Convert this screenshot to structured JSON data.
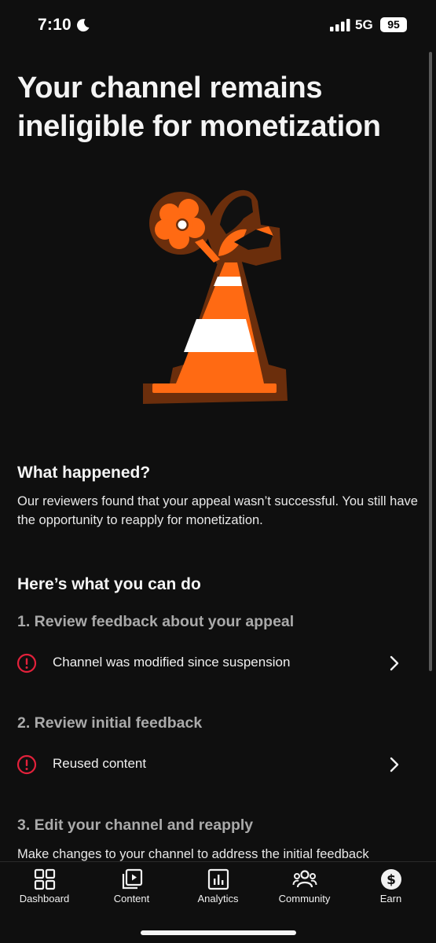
{
  "status_bar": {
    "time": "7:10",
    "network": "5G",
    "battery": "95"
  },
  "page": {
    "title": "Your channel remains ineligible for monetization",
    "what_happened": {
      "heading": "What happened?",
      "body": "Our reviewers found that your appeal wasn’t successful. You still have the opportunity to reapply for monetization."
    },
    "what_you_can_do": {
      "heading": "Here’s what you can do",
      "step1": {
        "heading": "1. Review feedback about your appeal",
        "item": "Channel was modified since suspension"
      },
      "step2": {
        "heading": "2. Review initial feedback",
        "item": "Reused content"
      },
      "step3": {
        "heading": "3. Edit your channel and reapply",
        "body": "Make changes to your channel to address the initial feedback"
      }
    }
  },
  "bottom_nav": {
    "items": [
      {
        "label": "Dashboard",
        "icon": "dashboard-icon"
      },
      {
        "label": "Content",
        "icon": "content-icon"
      },
      {
        "label": "Analytics",
        "icon": "analytics-icon"
      },
      {
        "label": "Community",
        "icon": "community-icon"
      },
      {
        "label": "Earn",
        "icon": "earn-icon"
      }
    ]
  },
  "colors": {
    "background": "#0f0f0f",
    "alert": "#e3213b",
    "cone_orange": "#ff6a13",
    "cone_outline": "#6b2e0c"
  }
}
